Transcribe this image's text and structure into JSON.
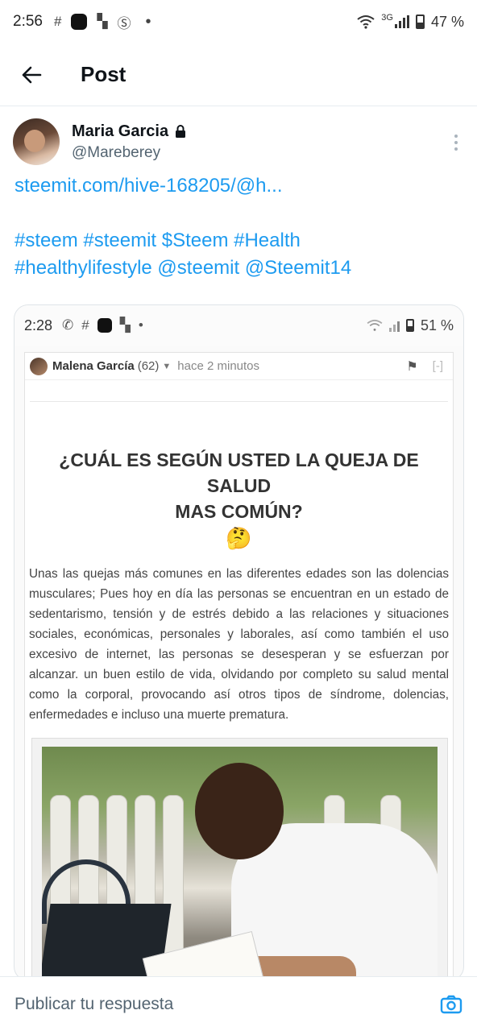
{
  "status_bar": {
    "time": "2:56",
    "network": "3G",
    "battery": "47 %"
  },
  "header": {
    "title": "Post"
  },
  "author": {
    "name": "Maria Garcia",
    "handle": "@Mareberey"
  },
  "post": {
    "link": "steemit.com/hive-168205/@h...",
    "hashtags_line1": "#steem #steemit $Steem #Health",
    "hashtags_line2": "#healthylifestyle @steemit @Steemit14"
  },
  "embedded_screenshot": {
    "status_time": "2:28",
    "status_battery": "51 %",
    "comment_author": "Malena García",
    "comment_reputation": "(62)",
    "comment_time": "hace 2 minutos",
    "collapse_label": "[-]",
    "title_line1": "¿CUÁL ES SEGÚN USTED LA QUEJA DE SALUD",
    "title_line2": "MAS COMÚN?",
    "emoji": "🤔",
    "body": "Unas las quejas más comunes en las diferentes edades son las dolencias musculares; Pues hoy en día las personas se encuentran en un estado de sedentarismo, tensión y de estrés debido a las relaciones y situaciones sociales, económicas, personales y laborales, así como también el uso excesivo de internet, las personas se desesperan y se esfuerzan por alcanzar. un buen estilo de vida, olvidando por completo su salud mental como la corporal, provocando así otros tipos de síndrome, dolencias, enfermedades e incluso una muerte prematura."
  },
  "reply_bar": {
    "placeholder": "Publicar tu respuesta"
  },
  "colors": {
    "link": "#1d9bf0",
    "text": "#0f1419",
    "muted": "#536471"
  }
}
